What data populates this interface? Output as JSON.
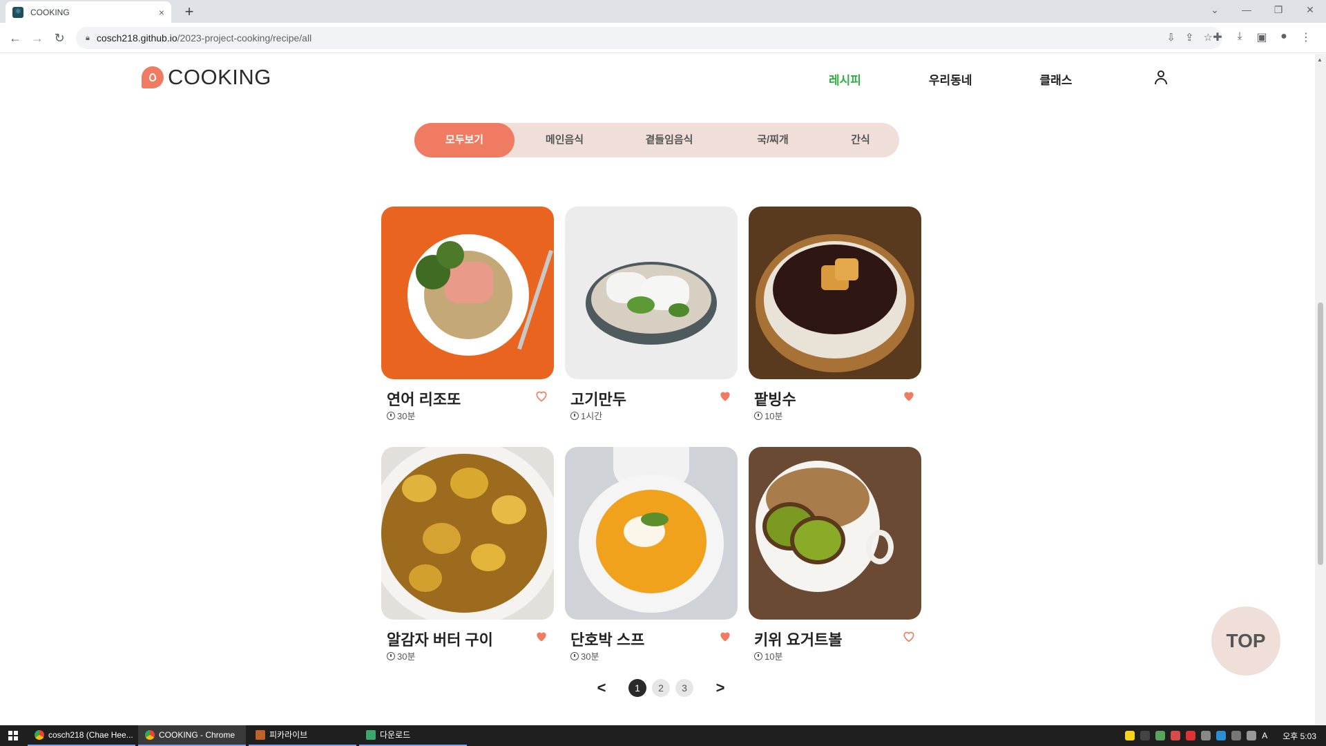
{
  "browser": {
    "tab_title": "COOKING",
    "tab_close": "×",
    "new_tab": "+",
    "url_host": "cosch218.github.io",
    "url_path": "/2023-project-cooking/recipe/all",
    "window_controls": [
      "⌄",
      "—",
      "❐",
      "✕"
    ]
  },
  "site": {
    "logo_text": "COOKING",
    "nav": [
      {
        "label": "레시피",
        "active": true
      },
      {
        "label": "우리동네",
        "active": false
      },
      {
        "label": "클래스",
        "active": false
      }
    ]
  },
  "categories": [
    {
      "label": "모두보기",
      "active": true
    },
    {
      "label": "메인음식",
      "active": false
    },
    {
      "label": "곁들임음식",
      "active": false
    },
    {
      "label": "국/찌개",
      "active": false
    },
    {
      "label": "간식",
      "active": false
    }
  ],
  "recipes": [
    {
      "title": "연어 리조또",
      "time": "30분",
      "liked": false
    },
    {
      "title": "고기만두",
      "time": "1시간",
      "liked": true
    },
    {
      "title": "팥빙수",
      "time": "10분",
      "liked": true
    },
    {
      "title": "알감자 버터 구이",
      "time": "30분",
      "liked": true
    },
    {
      "title": "단호박 스프",
      "time": "30분",
      "liked": true
    },
    {
      "title": "키위 요거트볼",
      "time": "10분",
      "liked": false
    }
  ],
  "pagination": {
    "prev": "<",
    "next": ">",
    "pages": [
      "1",
      "2",
      "3"
    ],
    "current": "1"
  },
  "top_button": "TOP",
  "taskbar": {
    "items": [
      "cosch218 (Chae Hee...",
      "COOKING - Chrome",
      "피카라이브",
      "다운로드"
    ],
    "time": "오후 5:03",
    "ime": "A"
  },
  "colors": {
    "accent": "#ef7b62",
    "nav_active": "#2bb13f",
    "category_bg": "#f0dfd9"
  }
}
